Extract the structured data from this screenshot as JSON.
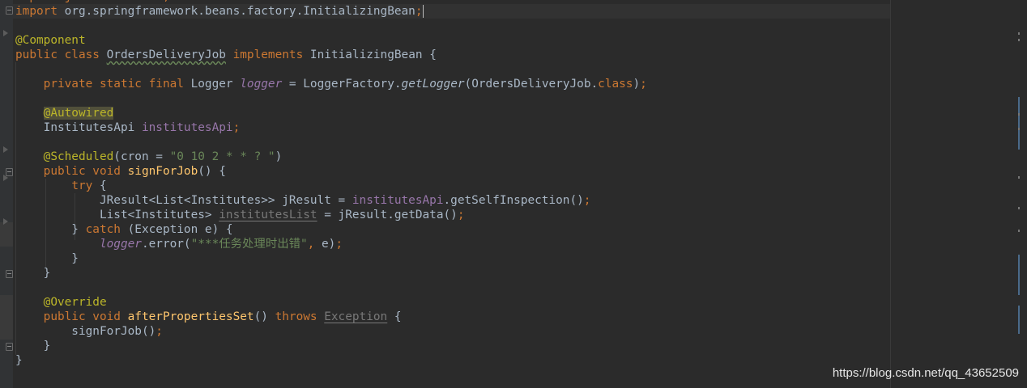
{
  "editor": {
    "lines": [
      [
        {
          "t": "import java.util.List;",
          "c": "kw"
        }
      ],
      [
        {
          "t": "import ",
          "c": "kw"
        },
        {
          "t": "org.springframework.beans.factory.InitializingBean"
        },
        {
          "t": ";",
          "c": "kw"
        },
        {
          "cursor": true
        }
      ],
      [],
      [
        {
          "t": "@Component",
          "c": "ann"
        }
      ],
      [
        {
          "t": "public class ",
          "c": "kw"
        },
        {
          "t": "OrdersDeliveryJob",
          "c": "typo"
        },
        {
          "t": " "
        },
        {
          "t": "implements ",
          "c": "kw"
        },
        {
          "t": "InitializingBean {"
        }
      ],
      [],
      [
        {
          "t": "    "
        },
        {
          "t": "private static final ",
          "c": "kw"
        },
        {
          "t": "Logger "
        },
        {
          "t": "logger",
          "c": "sfld"
        },
        {
          "t": " = LoggerFactory."
        },
        {
          "t": "getLogger",
          "c": "ital"
        },
        {
          "t": "(OrdersDeliveryJob."
        },
        {
          "t": "class",
          "c": "kw"
        },
        {
          "t": ")"
        },
        {
          "t": ";",
          "c": "kw"
        }
      ],
      [],
      [
        {
          "t": "    "
        },
        {
          "t": "@Autowired",
          "c": "ann-hl"
        }
      ],
      [
        {
          "t": "    InstitutesApi "
        },
        {
          "t": "institutesApi",
          "c": "fld"
        },
        {
          "t": ";",
          "c": "kw"
        }
      ],
      [],
      [
        {
          "t": "    "
        },
        {
          "t": "@Scheduled",
          "c": "ann"
        },
        {
          "t": "(cron = "
        },
        {
          "t": "\"0 10 2 * * ? \"",
          "c": "str"
        },
        {
          "t": ")"
        }
      ],
      [
        {
          "t": "    "
        },
        {
          "t": "public void ",
          "c": "kw"
        },
        {
          "t": "signForJob",
          "c": "mth"
        },
        {
          "t": "() {"
        }
      ],
      [
        {
          "t": "        "
        },
        {
          "t": "try ",
          "c": "kw"
        },
        {
          "t": "{"
        }
      ],
      [
        {
          "t": "            JResult<List<Institutes>> jResult = "
        },
        {
          "t": "institutesApi",
          "c": "fld"
        },
        {
          "t": ".getSelfInspection()"
        },
        {
          "t": ";",
          "c": "kw"
        }
      ],
      [
        {
          "t": "            List<Institutes> "
        },
        {
          "t": "institutesList",
          "c": "unused"
        },
        {
          "t": " = jResult.getData()"
        },
        {
          "t": ";",
          "c": "kw"
        }
      ],
      [
        {
          "t": "        } "
        },
        {
          "t": "catch ",
          "c": "kw"
        },
        {
          "t": "(Exception e) {"
        }
      ],
      [
        {
          "t": "            "
        },
        {
          "t": "logger",
          "c": "sfld"
        },
        {
          "t": ".error("
        },
        {
          "t": "\"***任务处理时出错\"",
          "c": "str"
        },
        {
          "t": ", ",
          "c": "kw"
        },
        {
          "t": "e)"
        },
        {
          "t": ";",
          "c": "kw"
        }
      ],
      [
        {
          "t": "        }"
        }
      ],
      [
        {
          "t": "    }"
        }
      ],
      [],
      [
        {
          "t": "    "
        },
        {
          "t": "@Override",
          "c": "ann"
        }
      ],
      [
        {
          "t": "    "
        },
        {
          "t": "public void ",
          "c": "kw"
        },
        {
          "t": "afterPropertiesSet",
          "c": "mth"
        },
        {
          "t": "() "
        },
        {
          "t": "throws ",
          "c": "kw"
        },
        {
          "t": "Exception",
          "c": "unused"
        },
        {
          "t": " {"
        }
      ],
      [
        {
          "t": "        signForJob()"
        },
        {
          "t": ";",
          "c": "kw"
        }
      ],
      [
        {
          "t": "    }"
        }
      ],
      [
        {
          "t": "}"
        }
      ]
    ]
  },
  "watermark": "https://blog.csdn.net/qq_43652509"
}
